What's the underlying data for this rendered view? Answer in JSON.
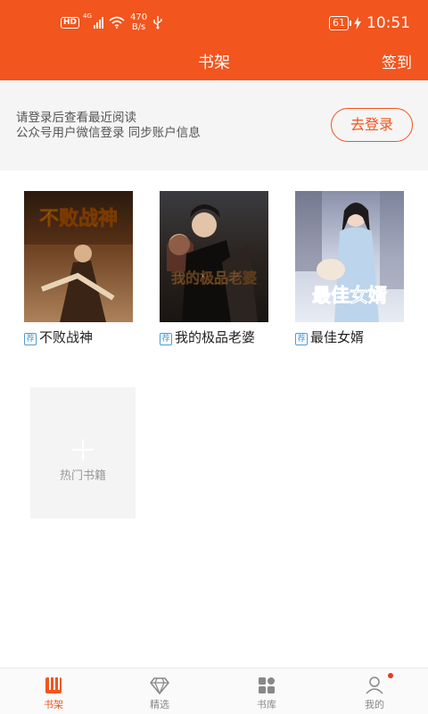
{
  "status_bar": {
    "hd_badge": "HD",
    "network_type": "4G",
    "speed_value": "470",
    "speed_unit": "B/s",
    "battery": "61",
    "time": "10:51"
  },
  "header": {
    "title": "书架",
    "checkin_label": "签到"
  },
  "login_banner": {
    "line1": "请登录后查看最近阅读",
    "line2": "公众号用户微信登录 同步账户信息",
    "button_label": "去登录"
  },
  "books": [
    {
      "title": "不败战神",
      "tag": "荐",
      "cover_text": "不败战神"
    },
    {
      "title": "我的极品老婆",
      "tag": "荐",
      "cover_text": "我的极品老婆"
    },
    {
      "title": "最佳女婿",
      "tag": "荐",
      "cover_text": "最佳女婿"
    }
  ],
  "add_books": {
    "label": "热门书籍"
  },
  "tabs": [
    {
      "label": "书架",
      "icon": "bookshelf-icon",
      "active": true
    },
    {
      "label": "精选",
      "icon": "diamond-icon",
      "active": false
    },
    {
      "label": "书库",
      "icon": "grid-icon",
      "active": false
    },
    {
      "label": "我的",
      "icon": "user-icon",
      "active": false
    }
  ],
  "colors": {
    "brand": "#f2551e",
    "tag": "#4b9bd6",
    "notification_dot": "#e8382a"
  }
}
